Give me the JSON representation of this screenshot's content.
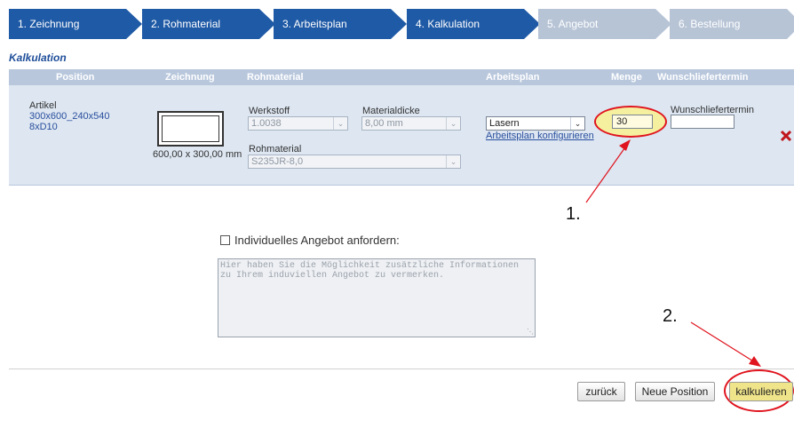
{
  "steps": [
    {
      "label": "1. Zeichnung",
      "active": true
    },
    {
      "label": "2. Rohmaterial",
      "active": true
    },
    {
      "label": "3. Arbeitsplan",
      "active": true
    },
    {
      "label": "4. Kalkulation",
      "active": true
    },
    {
      "label": "5. Angebot",
      "active": false
    },
    {
      "label": "6. Bestellung",
      "active": false
    }
  ],
  "colors": {
    "step_active": "#1f5aa6",
    "step_inactive": "#b7c4d6",
    "header": "#b8c7dc",
    "row": "#dde6f1",
    "highlight": "#f5f0a0",
    "annotation": "#e0141e"
  },
  "section_title": "Kalkulation",
  "table": {
    "headers": [
      "Position",
      "Zeichnung",
      "Rohmaterial",
      "Arbeitsplan",
      "Menge",
      "Wunschliefertermin"
    ],
    "row": {
      "artikel_label": "Artikel",
      "artikel_name": "300x600_240x540",
      "artikel_sub": "8xD10",
      "drawing_size": "600,00 x 300,00 mm",
      "werkstoff_label": "Werkstoff",
      "werkstoff_value": "1.0038",
      "materialdicke_label": "Materialdicke",
      "materialdicke_value": "8,00 mm",
      "rohmaterial_label": "Rohmaterial",
      "rohmaterial_value": "S235JR-8,0",
      "arbeitsplan_value": "Lasern",
      "arbeitsplan_link": "Arbeitsplan konfigurieren",
      "menge_value": "30",
      "wunsch_label": "Wunschliefertermin",
      "wunsch_value": "",
      "delete_icon": "delete-x-icon"
    }
  },
  "offer": {
    "checkbox_label": "Individuelles Angebot anfordern:",
    "textarea_placeholder": "Hier haben Sie die Möglichkeit zusätzliche Informationen zu Ihrem induviellen Angebot zu vermerken."
  },
  "annotations": {
    "one": "1.",
    "two": "2."
  },
  "buttons": {
    "back": "zurück",
    "new_position": "Neue Position",
    "calculate": "kalkulieren"
  }
}
